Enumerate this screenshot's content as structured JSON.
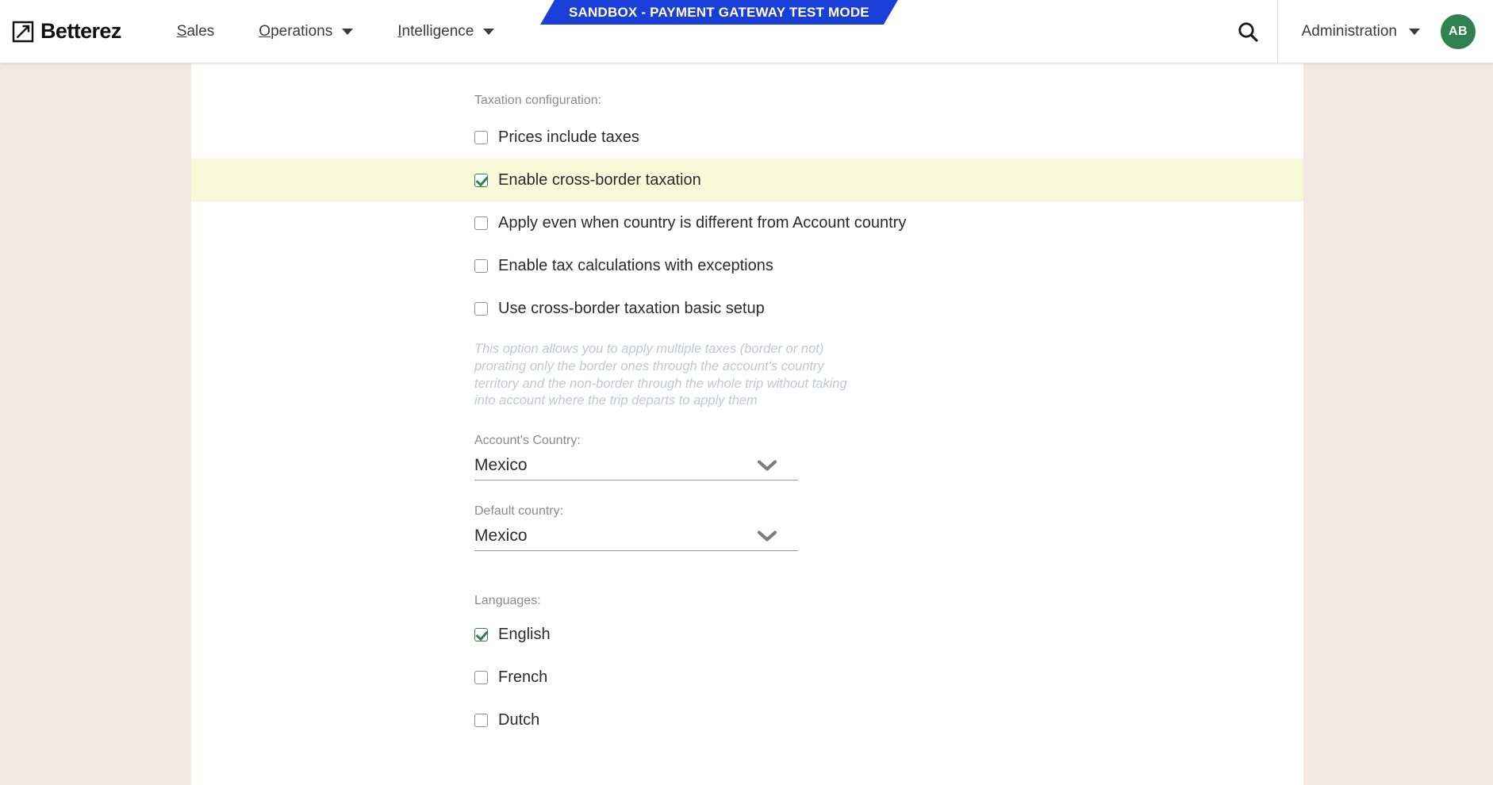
{
  "header": {
    "logo_text": "Betterez",
    "logo_icon": "arrow-square-logo-icon",
    "nav": [
      {
        "label": "Sales",
        "accesskey": "S",
        "has_caret": false
      },
      {
        "label": "Operations",
        "accesskey": "O",
        "has_caret": true
      },
      {
        "label": "Intelligence",
        "accesskey": "I",
        "has_caret": true
      }
    ],
    "sandbox_banner": "SANDBOX - PAYMENT GATEWAY TEST MODE",
    "sandbox_color": "#1a3ed8",
    "search_icon": "search-icon",
    "admin_menu": {
      "label": "Administration",
      "accesskey": "A",
      "has_caret": true
    },
    "avatar": {
      "initials": "AB",
      "color": "#2f8150"
    }
  },
  "form": {
    "taxation_label": "Taxation configuration:",
    "checkboxes": [
      {
        "label": "Prices include taxes",
        "checked": false,
        "highlighted": false
      },
      {
        "label": "Enable cross-border taxation",
        "checked": true,
        "highlighted": true
      },
      {
        "label": "Apply even when country is different from Account country",
        "checked": false,
        "highlighted": false
      },
      {
        "label": "Enable tax calculations with exceptions",
        "checked": false,
        "highlighted": false
      },
      {
        "label": "Use cross-border taxation basic setup",
        "checked": false,
        "highlighted": false
      }
    ],
    "help_text": "This option allows you to apply multiple taxes (border or not) prorating only the border ones through the account's country territory and the non-border through the whole trip without taking into account where the trip departs to apply them",
    "account_country": {
      "label": "Account's Country:",
      "value": "Mexico"
    },
    "default_country": {
      "label": "Default country:",
      "value": "Mexico"
    },
    "languages_label": "Languages:",
    "languages": [
      {
        "label": "English",
        "checked": true
      },
      {
        "label": "French",
        "checked": false
      },
      {
        "label": "Dutch",
        "checked": false
      }
    ]
  },
  "colors": {
    "page_background": "#f2eae2",
    "panel": "#ffffff",
    "highlight_row": "#f7f9d8",
    "accent_green": "#2f8150",
    "sandbox_blue": "#1a3ed8"
  }
}
